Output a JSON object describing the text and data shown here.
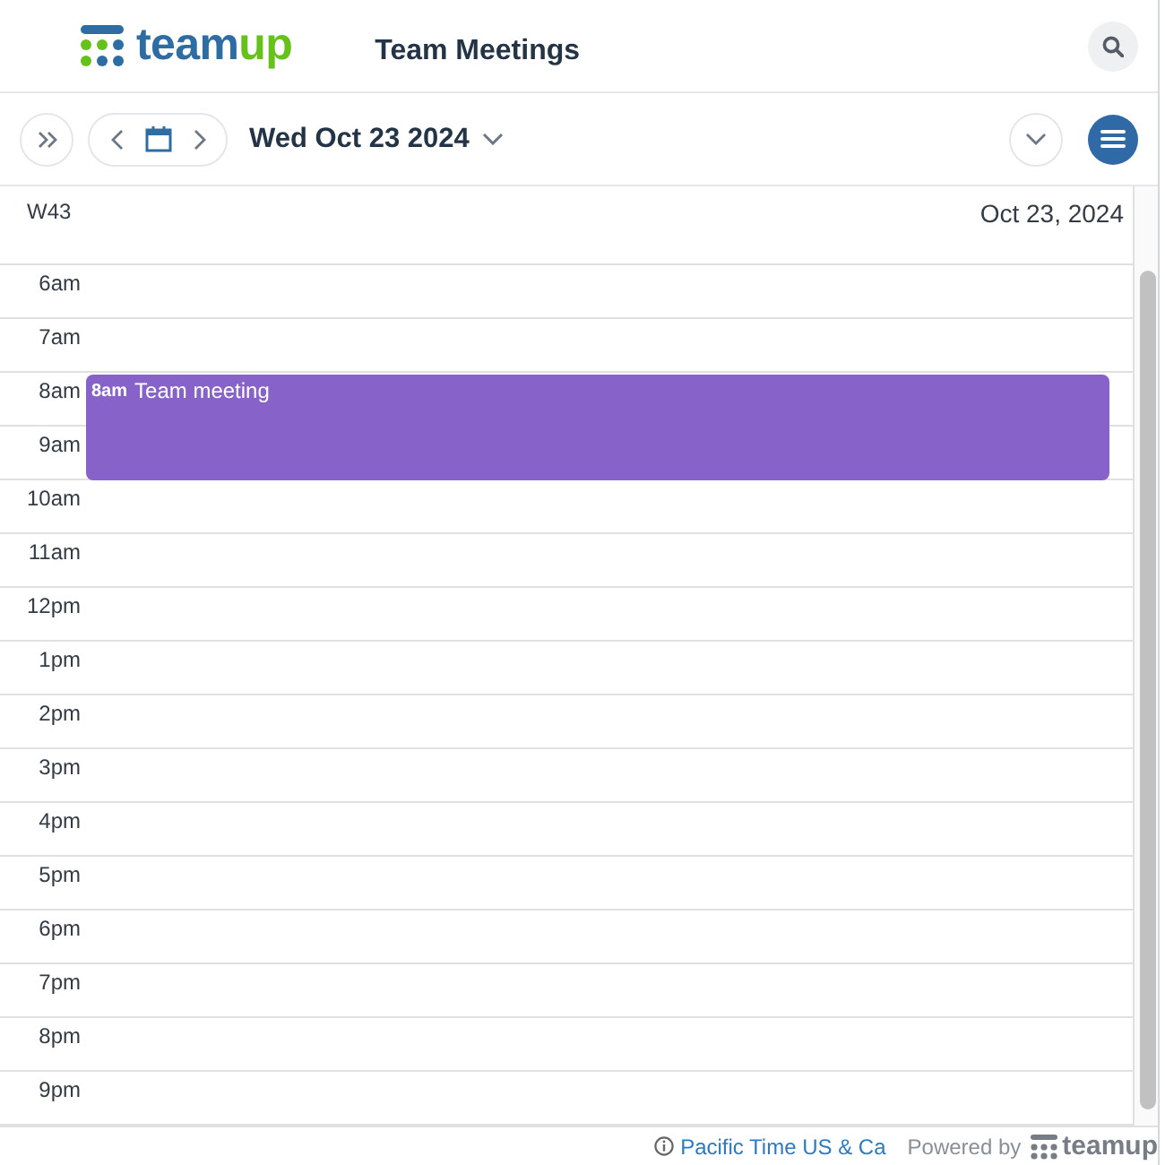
{
  "header": {
    "logo": {
      "text": "team",
      "accent_text": "up"
    },
    "title": "Team Meetings"
  },
  "toolbar": {
    "date": "Wed Oct 23 2024"
  },
  "day_header": {
    "week": "W43",
    "date": "Oct 23, 2024"
  },
  "hours": [
    {
      "label": "6am"
    },
    {
      "label": "7am"
    },
    {
      "label": "8am",
      "events": [
        {
          "time": "8am",
          "title": "Team meeting",
          "color": "#8763c9"
        }
      ]
    },
    {
      "label": "9am"
    },
    {
      "label": "10am"
    },
    {
      "label": "11am"
    },
    {
      "label": "12pm"
    },
    {
      "label": "1pm"
    },
    {
      "label": "2pm"
    },
    {
      "label": "3pm"
    },
    {
      "label": "4pm"
    },
    {
      "label": "5pm"
    },
    {
      "label": "6pm"
    },
    {
      "label": "7pm"
    },
    {
      "label": "8pm"
    },
    {
      "label": "9pm"
    }
  ],
  "footer": {
    "timezone": "Pacific Time US & Ca",
    "powered_by": "Powered by",
    "logo_text": "teamup"
  }
}
